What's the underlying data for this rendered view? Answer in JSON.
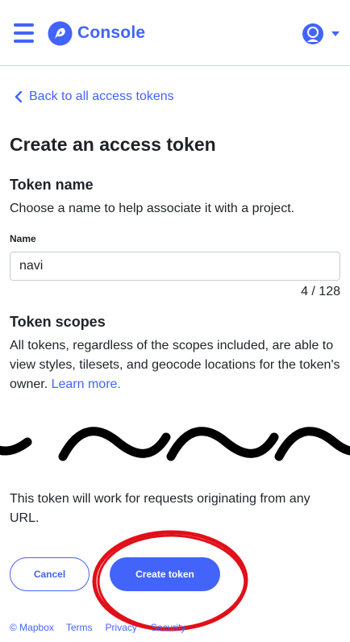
{
  "header": {
    "title": "Console",
    "menu_icon": "hamburger-menu-icon",
    "logo_icon": "mapbox-logo-icon",
    "account_icon": "user-avatar-icon",
    "caret_icon": "caret-down-icon"
  },
  "back_link": {
    "label": "Back to all access tokens"
  },
  "page_title": "Create an access token",
  "token_name": {
    "heading": "Token name",
    "description": "Choose a name to help associate it with a project.",
    "field_label": "Name",
    "value": "navi",
    "char_count": "4 / 128"
  },
  "token_scopes": {
    "heading": "Token scopes",
    "description": "All tokens, regardless of the scopes included, are able to view styles, tilesets, and geocode locations for the token's owner.",
    "learn_more": "Learn more."
  },
  "url_note": "This token will work for requests originating from any URL.",
  "actions": {
    "cancel_label": "Cancel",
    "create_label": "Create token"
  },
  "footer": {
    "copyright": "© Mapbox",
    "terms": "Terms",
    "privacy": "Privacy",
    "security": "Security"
  },
  "colors": {
    "accent": "#4264fb",
    "annotation": "#e0101a",
    "text": "#1f2328"
  }
}
